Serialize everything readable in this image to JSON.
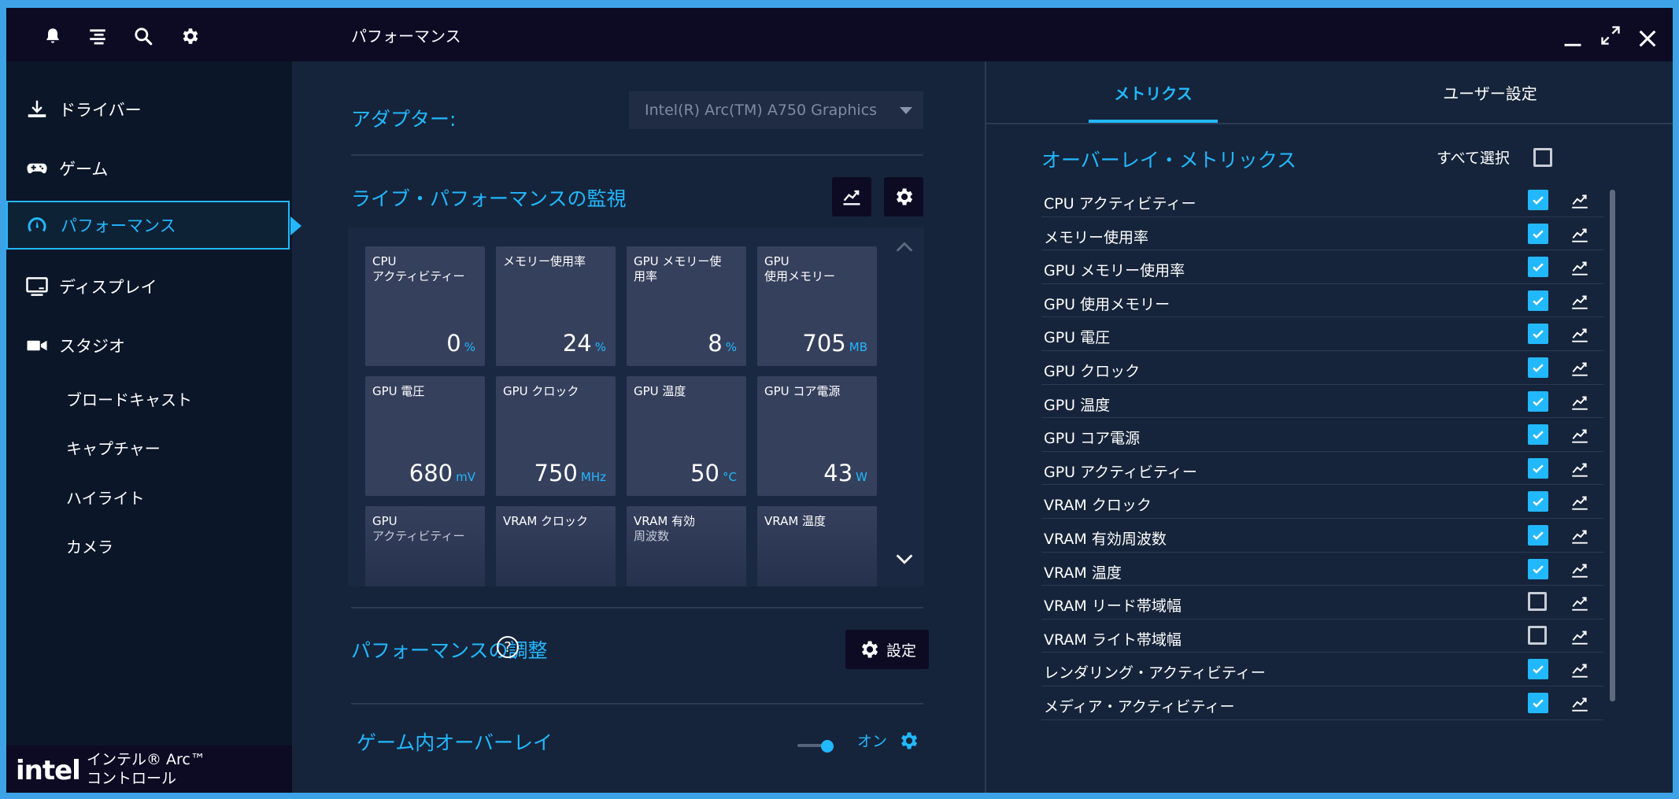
{
  "header": {
    "title": "パフォーマンス"
  },
  "sidebar": {
    "nav": [
      {
        "label": "ドライバー"
      },
      {
        "label": "ゲーム"
      },
      {
        "label": "パフォーマンス"
      },
      {
        "label": "ディスプレイ"
      },
      {
        "label": "スタジオ"
      }
    ],
    "sub": [
      {
        "label": "ブロードキャスト"
      },
      {
        "label": "キャプチャー"
      },
      {
        "label": "ハイライト"
      },
      {
        "label": "カメラ"
      }
    ],
    "brand": {
      "logo": "intel",
      "line1": "インテル® Arc™",
      "line2": "コントロール"
    }
  },
  "main": {
    "adapter_label": "アダプター:",
    "adapter_value": "Intel(R) Arc(TM) A750 Graphics",
    "live_title": "ライブ・パフォーマンスの監視",
    "tiles": [
      {
        "label1": "CPU",
        "label2": "アクティビティー",
        "value": "0",
        "unit": "%"
      },
      {
        "label1": "メモリー使用率",
        "label2": "",
        "value": "24",
        "unit": "%"
      },
      {
        "label1": "GPU メモリー使",
        "label2": "用率",
        "value": "8",
        "unit": "%"
      },
      {
        "label1": "GPU",
        "label2": "使用メモリー",
        "value": "705",
        "unit": "MB"
      },
      {
        "label1": "GPU 電圧",
        "label2": "",
        "value": "680",
        "unit": "mV"
      },
      {
        "label1": "GPU クロック",
        "label2": "",
        "value": "750",
        "unit": "MHz"
      },
      {
        "label1": "GPU 温度",
        "label2": "",
        "value": "50",
        "unit": "°C"
      },
      {
        "label1": "GPU コア電源",
        "label2": "",
        "value": "43",
        "unit": "W"
      },
      {
        "label1": "GPU",
        "label2": "アクティビティー",
        "value": "",
        "unit": ""
      },
      {
        "label1": "VRAM クロック",
        "label2": "",
        "value": "",
        "unit": ""
      },
      {
        "label1": "VRAM 有効",
        "label2": "周波数",
        "value": "",
        "unit": ""
      },
      {
        "label1": "VRAM 温度",
        "label2": "",
        "value": "",
        "unit": ""
      }
    ],
    "tuning_title": "パフォーマンスの調整",
    "tuning_button": "設定",
    "overlay_title": "ゲーム内オーバーレイ",
    "overlay_toggle": "オン"
  },
  "right": {
    "tabs": [
      {
        "label": "メトリクス"
      },
      {
        "label": "ユーザー設定"
      }
    ],
    "overlay_title": "オーバーレイ・メトリックス",
    "select_all": "すべて選択",
    "select_all_checked": false,
    "metrics": [
      {
        "label": "CPU アクティビティー",
        "checked": true
      },
      {
        "label": "メモリー使用率",
        "checked": true
      },
      {
        "label": "GPU メモリー使用率",
        "checked": true
      },
      {
        "label": "GPU 使用メモリー",
        "checked": true
      },
      {
        "label": "GPU 電圧",
        "checked": true
      },
      {
        "label": "GPU クロック",
        "checked": true
      },
      {
        "label": "GPU 温度",
        "checked": true
      },
      {
        "label": "GPU コア電源",
        "checked": true
      },
      {
        "label": "GPU アクティビティー",
        "checked": true
      },
      {
        "label": "VRAM クロック",
        "checked": true
      },
      {
        "label": "VRAM 有効周波数",
        "checked": true
      },
      {
        "label": "VRAM 温度",
        "checked": true
      },
      {
        "label": "VRAM リード帯域幅",
        "checked": false
      },
      {
        "label": "VRAM ライト帯域幅",
        "checked": false
      },
      {
        "label": "レンダリング・アクティビティー",
        "checked": true
      },
      {
        "label": "メディア・アクティビティー",
        "checked": true
      }
    ]
  },
  "colors": {
    "accent": "#22b8ff",
    "background": "#15243a",
    "sidebar": "#0b1628",
    "titlebar": "#0d0b24"
  }
}
